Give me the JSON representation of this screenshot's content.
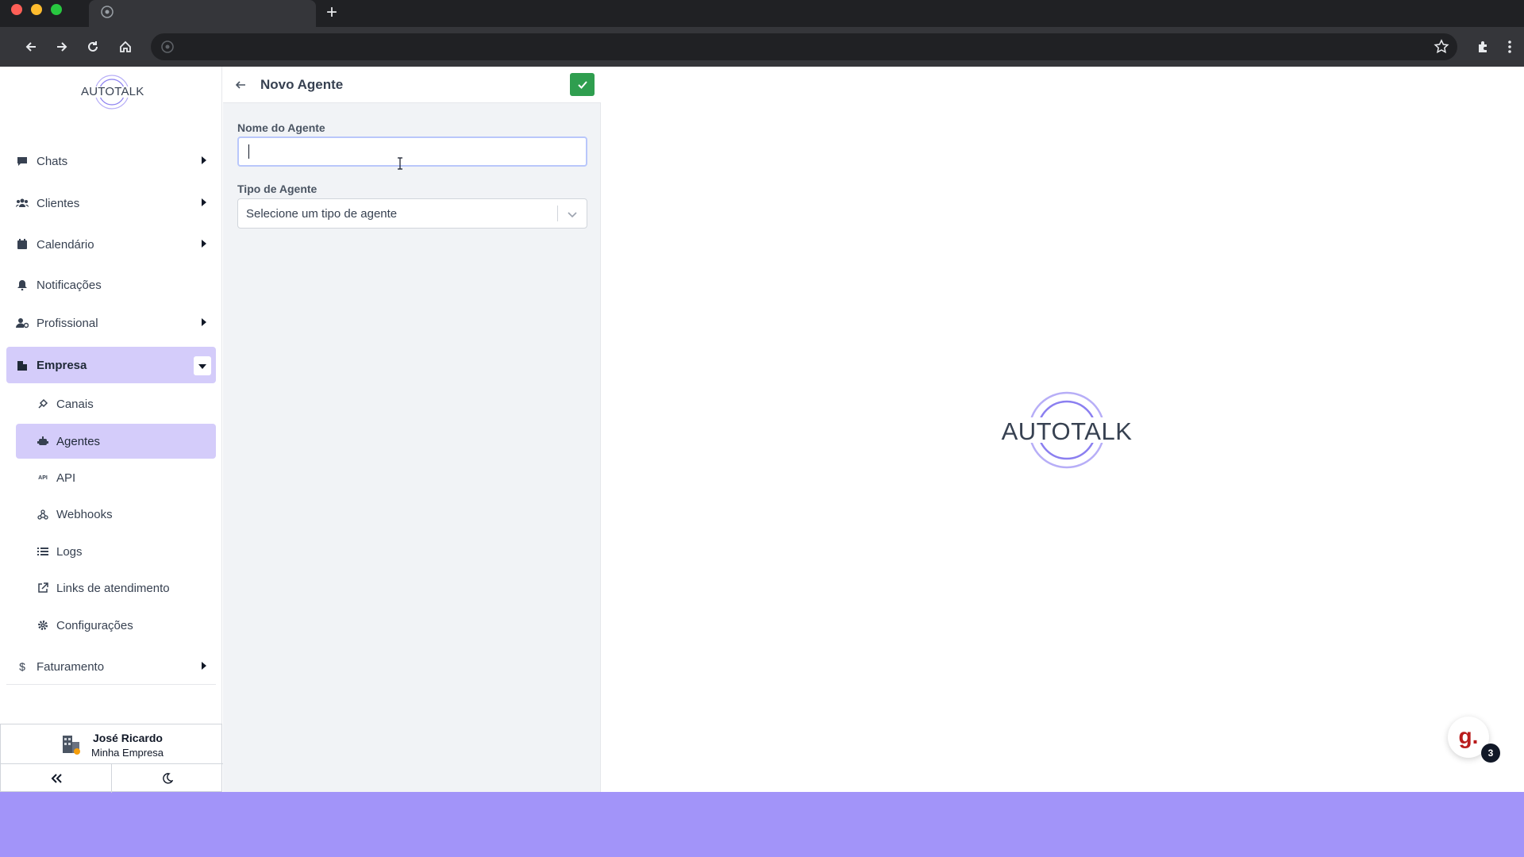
{
  "sidebar": {
    "logo_text": "AUTOTALK",
    "items": [
      {
        "label": "Chats",
        "icon": "chat-icon"
      },
      {
        "label": "Clientes",
        "icon": "users-icon"
      },
      {
        "label": "Calendário",
        "icon": "calendar-icon"
      },
      {
        "label": "Notificações",
        "icon": "bell-icon"
      },
      {
        "label": "Profissional",
        "icon": "user-cog-icon"
      },
      {
        "label": "Empresa",
        "icon": "building-icon"
      },
      {
        "label": "Faturamento",
        "icon": "dollar-icon"
      }
    ],
    "sub_items": [
      {
        "label": "Canais",
        "icon": "plug-icon"
      },
      {
        "label": "Agentes",
        "icon": "robot-icon"
      },
      {
        "label": "API",
        "icon": "api-icon"
      },
      {
        "label": "Webhooks",
        "icon": "webhook-icon"
      },
      {
        "label": "Logs",
        "icon": "list-icon"
      },
      {
        "label": "Links de atendimento",
        "icon": "external-link-icon"
      },
      {
        "label": "Configurações",
        "icon": "gear-icon"
      }
    ],
    "active_item": "Empresa",
    "active_sub_item": "Agentes"
  },
  "user": {
    "name": "José Ricardo",
    "company": "Minha Empresa"
  },
  "form": {
    "title": "Novo Agente",
    "name_label": "Nome do Agente",
    "name_value": "",
    "type_label": "Tipo de Agente",
    "type_placeholder": "Selecione um tipo de agente"
  },
  "main": {
    "logo_text": "AUTOTALK"
  },
  "chat_widget": {
    "letter": "g.",
    "badge_count": "3"
  },
  "colors": {
    "accent": "#d4ccfa",
    "save_green": "#2f9e4f",
    "footer_purple": "#a294f9",
    "logo_ring": "#8b7ff0"
  }
}
